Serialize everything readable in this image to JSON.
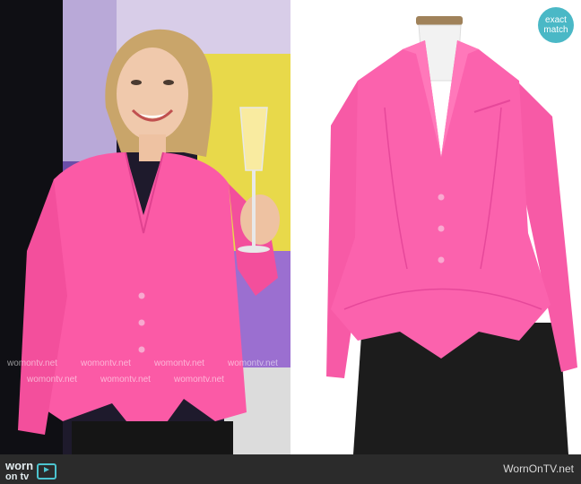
{
  "left_photo": {
    "watermark": "womontv.net"
  },
  "right_photo": {
    "badge_line1": "exact",
    "badge_line2": "match"
  },
  "footer": {
    "logo_word": "worn",
    "logo_word2": "on tv",
    "credit": "WornOnTV.net"
  },
  "colors": {
    "jacket_pink": "#fb5aa6",
    "badge": "#4ab8c6",
    "footer_bg": "#2b2b2b"
  }
}
